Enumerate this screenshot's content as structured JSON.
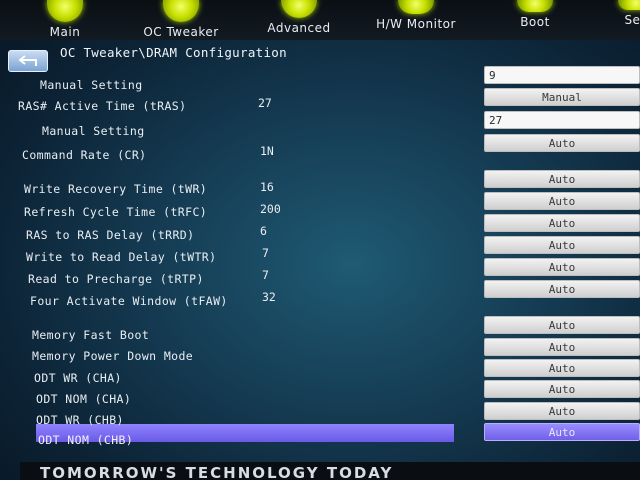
{
  "nav": [
    {
      "label": "Main",
      "icon": "home-icon"
    },
    {
      "label": "OC Tweaker",
      "icon": "oc-tweaker-icon"
    },
    {
      "label": "Advanced",
      "icon": "advanced-icon"
    },
    {
      "label": "H/W Monitor",
      "icon": "monitor-icon"
    },
    {
      "label": "Boot",
      "icon": "boot-icon"
    },
    {
      "label": "Sec",
      "icon": "security-icon"
    }
  ],
  "breadcrumb": "OC Tweaker\\DRAM Configuration",
  "settings": [
    {
      "label": "Manual Setting",
      "value": "",
      "box": "9"
    },
    {
      "label": "RAS# Active Time (tRAS)",
      "value": "27",
      "box": "Manual"
    },
    {
      "label": "Manual Setting",
      "value": "",
      "box": "27"
    },
    {
      "label": "Command Rate (CR)",
      "value": "1N",
      "box": "Auto"
    },
    {
      "label": "Write Recovery Time (tWR)",
      "value": "16",
      "box": "Auto"
    },
    {
      "label": "Refresh Cycle Time (tRFC)",
      "value": "200",
      "box": "Auto"
    },
    {
      "label": "RAS to RAS Delay (tRRD)",
      "value": "6",
      "box": "Auto"
    },
    {
      "label": "Write to Read Delay (tWTR)",
      "value": "7",
      "box": "Auto"
    },
    {
      "label": "Read to Precharge (tRTP)",
      "value": "7",
      "box": "Auto"
    },
    {
      "label": "Four Activate Window (tFAW)",
      "value": "32",
      "box": "Auto"
    },
    {
      "label": "Memory Fast Boot",
      "value": "",
      "box": "Auto"
    },
    {
      "label": "Memory Power Down Mode",
      "value": "",
      "box": "Auto"
    },
    {
      "label": "ODT WR (CHA)",
      "value": "",
      "box": "Auto"
    },
    {
      "label": "ODT NOM (CHA)",
      "value": "",
      "box": "Auto"
    },
    {
      "label": "ODT WR (CHB)",
      "value": "",
      "box": "Auto"
    },
    {
      "label": "ODT NOM (CHB)",
      "value": "",
      "box": "Auto"
    }
  ],
  "footer": "TOMORROW'S TECHNOLOGY TODAY"
}
